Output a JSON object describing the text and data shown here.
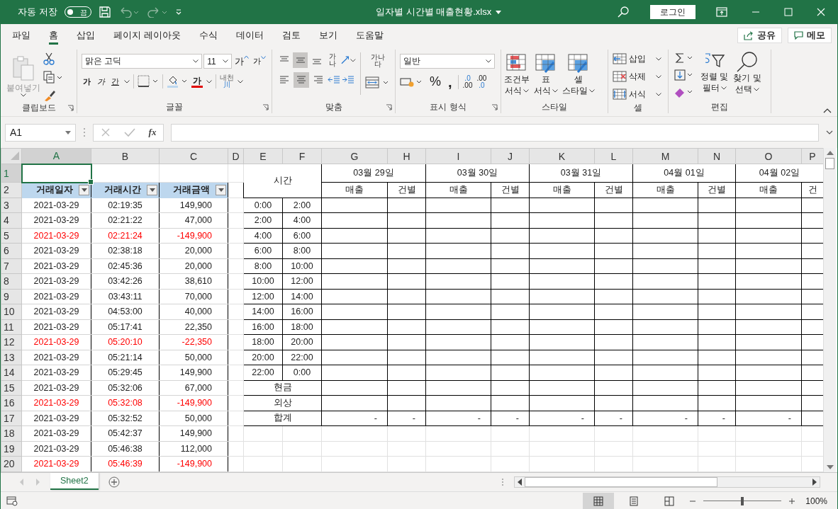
{
  "title_bar": {
    "autosave_label": "자동 저장",
    "autosave": {
      "on": false,
      "label": "끔"
    },
    "file_name": "일자별 시간별 매출현황.xlsx",
    "login_button": "로그인"
  },
  "ribbon_tabs": [
    {
      "label": "파일",
      "selected": false
    },
    {
      "label": "홈",
      "selected": true
    },
    {
      "label": "삽입",
      "selected": false
    },
    {
      "label": "페이지 레이아웃",
      "selected": false
    },
    {
      "label": "수식",
      "selected": false
    },
    {
      "label": "데이터",
      "selected": false
    },
    {
      "label": "검토",
      "selected": false
    },
    {
      "label": "보기",
      "selected": false
    },
    {
      "label": "도움말",
      "selected": false
    }
  ],
  "share_button": "공유",
  "comments_button": "메모",
  "clipboard": {
    "paste_label": "붙여넣기",
    "group_label": "클립보드"
  },
  "font": {
    "font_name": "맑은 고딕",
    "font_size": "11",
    "grow_glyph": "가",
    "shrink_glyph": "가",
    "bold_glyph": "가",
    "italic_glyph": "가",
    "underline_glyph": "간",
    "font_color_glyph": "가",
    "phonetic_glyph_top": "내천",
    "phonetic_glyph_bottom": "川",
    "group_label": "글꼴"
  },
  "alignment": {
    "orientation_glyph": "가나",
    "wrap_glyph_top": "가나",
    "wrap_glyph_bottom": "다",
    "group_label": "맞춤",
    "vertical_options": [
      {
        "selected": false
      },
      {
        "selected": true
      },
      {
        "selected": false
      }
    ],
    "horizontal_options": [
      {
        "selected": false
      },
      {
        "selected": true
      },
      {
        "selected": false
      }
    ]
  },
  "number": {
    "format": "일반",
    "percent_glyph": "%",
    "comma_glyph": ",",
    "decimal_increase": {
      "top": ".0",
      "bottom": ".00"
    },
    "decimal_decrease": {
      "top": ".00",
      "bottom": ".0"
    },
    "group_label": "표시 형식"
  },
  "styles": {
    "buttons": [
      {
        "top": "조건부",
        "bottom": "서식"
      },
      {
        "top": "표",
        "bottom": "서식"
      },
      {
        "top": "셀",
        "bottom": "스타일"
      }
    ],
    "group_label": "스타일"
  },
  "cells": {
    "buttons": [
      "삽입",
      "삭제",
      "서식"
    ],
    "group_label": "셀"
  },
  "editing": {
    "sort_filter": {
      "top": "정렬 및",
      "bottom": "필터"
    },
    "find_select": {
      "top": "찾기 및",
      "bottom": "선택"
    },
    "group_label": "편집"
  },
  "formula_bar": {
    "name_box": "A1",
    "function_glyph": "fx"
  },
  "columns": [
    {
      "label": "A",
      "selected": true
    },
    {
      "label": "B",
      "selected": false
    },
    {
      "label": "C",
      "selected": false
    },
    {
      "label": "D",
      "selected": false
    },
    {
      "label": "E",
      "selected": false
    },
    {
      "label": "F",
      "selected": false
    },
    {
      "label": "G",
      "selected": false
    },
    {
      "label": "H",
      "selected": false
    },
    {
      "label": "I",
      "selected": false
    },
    {
      "label": "J",
      "selected": false
    },
    {
      "label": "K",
      "selected": false
    },
    {
      "label": "L",
      "selected": false
    },
    {
      "label": "M",
      "selected": false
    },
    {
      "label": "N",
      "selected": false
    },
    {
      "label": "O",
      "selected": false
    },
    {
      "label": "P",
      "selected": false
    }
  ],
  "row_headers": [
    {
      "label": "1",
      "selected": true
    },
    {
      "label": "2",
      "selected": false
    },
    {
      "label": "3",
      "selected": false
    },
    {
      "label": "4",
      "selected": false
    },
    {
      "label": "5",
      "selected": false
    },
    {
      "label": "6",
      "selected": false
    },
    {
      "label": "7",
      "selected": false
    },
    {
      "label": "8",
      "selected": false
    },
    {
      "label": "9",
      "selected": false
    },
    {
      "label": "10",
      "selected": false
    },
    {
      "label": "11",
      "selected": false
    },
    {
      "label": "12",
      "selected": false
    },
    {
      "label": "13",
      "selected": false
    },
    {
      "label": "14",
      "selected": false
    },
    {
      "label": "15",
      "selected": false
    },
    {
      "label": "16",
      "selected": false
    },
    {
      "label": "17",
      "selected": false
    },
    {
      "label": "18",
      "selected": false
    },
    {
      "label": "19",
      "selected": false
    },
    {
      "label": "20",
      "selected": false
    }
  ],
  "table_headers": [
    "거래일자",
    "거래시간",
    "거래금액"
  ],
  "transactions": [
    {
      "date": "2021-03-29",
      "time": "02:19:35",
      "amount": "149,900",
      "negative": false
    },
    {
      "date": "2021-03-29",
      "time": "02:21:22",
      "amount": "47,000",
      "negative": false
    },
    {
      "date": "2021-03-29",
      "time": "02:21:24",
      "amount": "-149,900",
      "negative": true
    },
    {
      "date": "2021-03-29",
      "time": "02:38:18",
      "amount": "20,000",
      "negative": false
    },
    {
      "date": "2021-03-29",
      "time": "02:45:36",
      "amount": "20,000",
      "negative": false
    },
    {
      "date": "2021-03-29",
      "time": "03:42:26",
      "amount": "38,610",
      "negative": false
    },
    {
      "date": "2021-03-29",
      "time": "03:43:11",
      "amount": "70,000",
      "negative": false
    },
    {
      "date": "2021-03-29",
      "time": "04:53:00",
      "amount": "40,000",
      "negative": false
    },
    {
      "date": "2021-03-29",
      "time": "05:17:41",
      "amount": "22,350",
      "negative": false
    },
    {
      "date": "2021-03-29",
      "time": "05:20:10",
      "amount": "-22,350",
      "negative": true
    },
    {
      "date": "2021-03-29",
      "time": "05:21:14",
      "amount": "50,000",
      "negative": false
    },
    {
      "date": "2021-03-29",
      "time": "05:29:45",
      "amount": "149,900",
      "negative": false
    },
    {
      "date": "2021-03-29",
      "time": "05:32:06",
      "amount": "67,000",
      "negative": false
    },
    {
      "date": "2021-03-29",
      "time": "05:32:08",
      "amount": "-149,900",
      "negative": true
    },
    {
      "date": "2021-03-29",
      "time": "05:32:52",
      "amount": "50,000",
      "negative": false
    },
    {
      "date": "2021-03-29",
      "time": "05:42:37",
      "amount": "149,900",
      "negative": false
    },
    {
      "date": "2021-03-29",
      "time": "05:46:38",
      "amount": "112,000",
      "negative": false
    },
    {
      "date": "2021-03-29",
      "time": "05:46:39",
      "amount": "-149,900",
      "negative": true
    }
  ],
  "time_header": "시간",
  "time_slots": [
    {
      "from": "0:00",
      "to": "2:00"
    },
    {
      "from": "2:00",
      "to": "4:00"
    },
    {
      "from": "4:00",
      "to": "6:00"
    },
    {
      "from": "6:00",
      "to": "8:00"
    },
    {
      "from": "8:00",
      "to": "10:00"
    },
    {
      "from": "10:00",
      "to": "12:00"
    },
    {
      "from": "12:00",
      "to": "14:00"
    },
    {
      "from": "14:00",
      "to": "16:00"
    },
    {
      "from": "16:00",
      "to": "18:00"
    },
    {
      "from": "18:00",
      "to": "20:00"
    },
    {
      "from": "20:00",
      "to": "22:00"
    },
    {
      "from": "22:00",
      "to": "0:00"
    }
  ],
  "days": [
    {
      "date": "03월 29일",
      "sales_label": "매출",
      "count_label": "건별"
    },
    {
      "date": "03월 30일",
      "sales_label": "매출",
      "count_label": "건별"
    },
    {
      "date": "03월 31일",
      "sales_label": "매출",
      "count_label": "건별"
    },
    {
      "date": "04월 01일",
      "sales_label": "매출",
      "count_label": "건별"
    },
    {
      "date": "04월 02일",
      "sales_label": "매출",
      "count_label": "건"
    }
  ],
  "summary_rows": [
    {
      "label": "현금"
    },
    {
      "label": "외상"
    },
    {
      "label": "합계",
      "values": [
        "-",
        "-",
        "-",
        "-",
        "-",
        "-",
        "-",
        "-",
        "-"
      ]
    }
  ],
  "sheet_tabs": [
    {
      "label": "Sheet2",
      "selected": true
    }
  ],
  "status_bar": {
    "views": [
      {
        "kind": "normal",
        "selected": true
      },
      {
        "kind": "page_layout",
        "selected": false
      },
      {
        "kind": "page_break",
        "selected": false
      }
    ],
    "zoom": {
      "level": 0.5,
      "label": "100%"
    }
  }
}
